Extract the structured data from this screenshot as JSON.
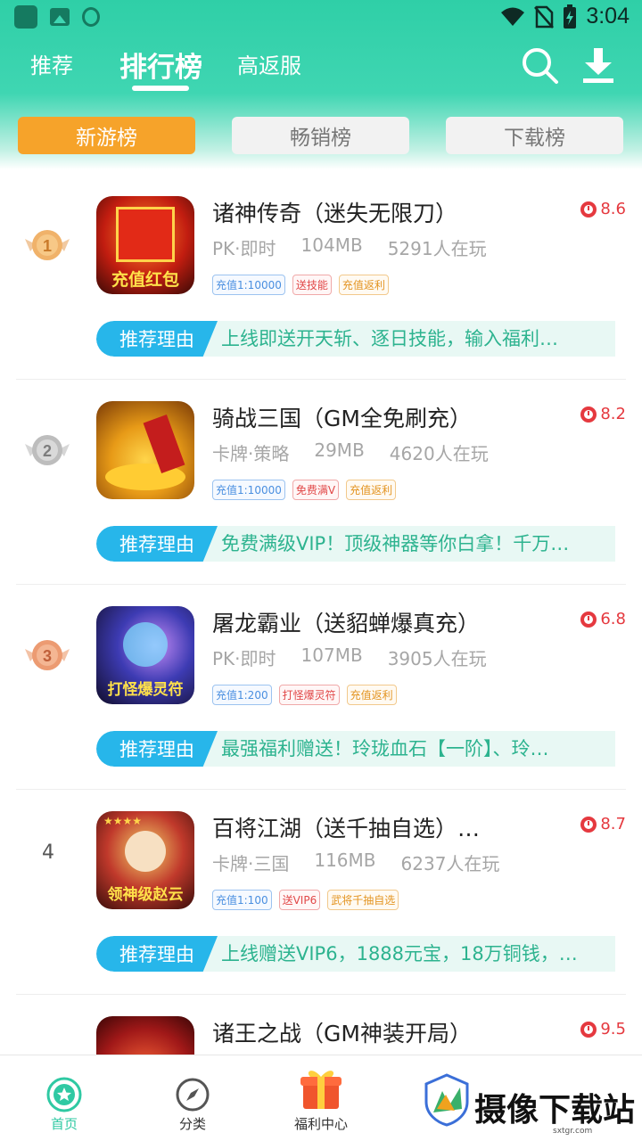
{
  "status_bar": {
    "time": "3:04"
  },
  "top_tabs": [
    "推荐",
    "排行榜",
    "高返服"
  ],
  "sub_tabs": [
    "新游榜",
    "畅销榜",
    "下载榜"
  ],
  "reason_label": "推荐理由",
  "games": [
    {
      "rank": "1",
      "name": "诸神传奇（迷失无限刀）",
      "score": "8.6",
      "genre": "PK·即时",
      "size": "104MB",
      "players": "5291人在玩",
      "tags": [
        "充值1:10000",
        "送技能",
        "充值返利"
      ],
      "reason": "上线即送开天斩、逐日技能，输入福利…",
      "icon_text": "充值红包"
    },
    {
      "rank": "2",
      "name": "骑战三国（GM全免刷充）",
      "score": "8.2",
      "genre": "卡牌·策略",
      "size": "29MB",
      "players": "4620人在玩",
      "tags": [
        "充值1:10000",
        "免费满V",
        "充值返利"
      ],
      "reason": "免费满级VIP！顶级神器等你白拿！千万…",
      "icon_text": ""
    },
    {
      "rank": "3",
      "name": "屠龙霸业（送貂蝉爆真充）",
      "score": "6.8",
      "genre": "PK·即时",
      "size": "107MB",
      "players": "3905人在玩",
      "tags": [
        "充值1:200",
        "打怪爆灵符",
        "充值返利"
      ],
      "reason": "最强福利赠送！玲珑血石【一阶】、玲…",
      "icon_text": "打怪爆灵符"
    },
    {
      "rank": "4",
      "name": "百将江湖（送千抽自选）…",
      "score": "8.7",
      "genre": "卡牌·三国",
      "size": "116MB",
      "players": "6237人在玩",
      "tags": [
        "充值1:100",
        "送VIP6",
        "武将千抽自选"
      ],
      "reason": "上线赠送VIP6，1888元宝，18万铜钱，…",
      "icon_text": "领神级赵云"
    },
    {
      "rank": "5",
      "name": "诸王之战（GM神装开局）",
      "score": "9.5",
      "genre": "",
      "size": "",
      "players": "",
      "tags": [],
      "reason": "",
      "icon_text": ""
    }
  ],
  "bottom_nav": [
    "首页",
    "分类",
    "福利中心"
  ],
  "watermark": {
    "text": "摄像下载站",
    "sub": "sxtgr.com"
  },
  "colors": {
    "accent": "#2fcfa7",
    "active_subtab": "#f6a32a",
    "score": "#e5393f",
    "reason_label": "#27b6ea"
  }
}
